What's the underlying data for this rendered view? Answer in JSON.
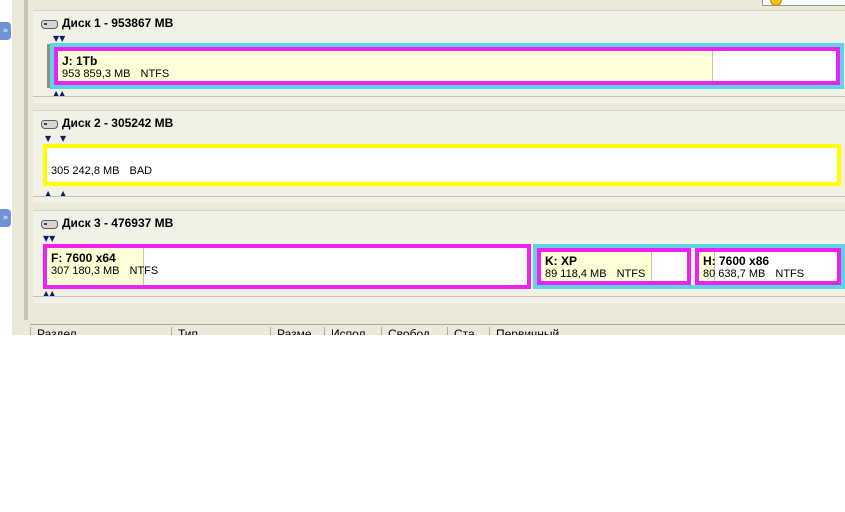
{
  "disks": [
    {
      "title": "Диск 1 - 953867 MB",
      "partitions": [
        {
          "name": "J:  1Tb",
          "size": "953 859,3 MB",
          "fs": "NTFS",
          "used_fraction": 0.84,
          "border": "magenta",
          "outer": "cyan"
        }
      ]
    },
    {
      "title": "Диск 2 - 305242 MB",
      "partitions": [
        {
          "name": "",
          "size": "305 242,8 MB",
          "fs": "BAD",
          "used_fraction": 0,
          "border": "yellow"
        }
      ]
    },
    {
      "title": "Диск 3 - 476937 MB",
      "partitions": [
        {
          "name": "F:  7600 x64",
          "size": "307 180,3 MB",
          "fs": "NTFS",
          "used_fraction": 0.2,
          "border": "magenta"
        },
        {
          "name": "K:  XP",
          "size": "89 118,4 MB",
          "fs": "NTFS",
          "used_fraction": 0.75,
          "border": "magenta",
          "outer": "cyan"
        },
        {
          "name": "H:  7600 x86",
          "size": "80 638,7 MB",
          "fs": "NTFS",
          "used_fraction": 0.11,
          "border": "magenta",
          "outer": "cyan"
        }
      ]
    }
  ],
  "table_columns": [
    "Раздел",
    "Тип",
    "Разме",
    "Испол",
    "Свобод",
    "Ста",
    "Первичный"
  ],
  "markers": {
    "down": "▼▼",
    "up": "▲▲",
    "down_single": "▼",
    "up_single": "▲"
  },
  "icons": {
    "disk": "hard-disk-icon",
    "left_buttons": "chevron-icon"
  },
  "colors": {
    "magenta": "#ee22ee",
    "cyan": "#5fd2e4",
    "yellow": "#ffff00",
    "used": "#ffffd8",
    "panel": "#f2f1e6",
    "background": "#ece9d8"
  }
}
